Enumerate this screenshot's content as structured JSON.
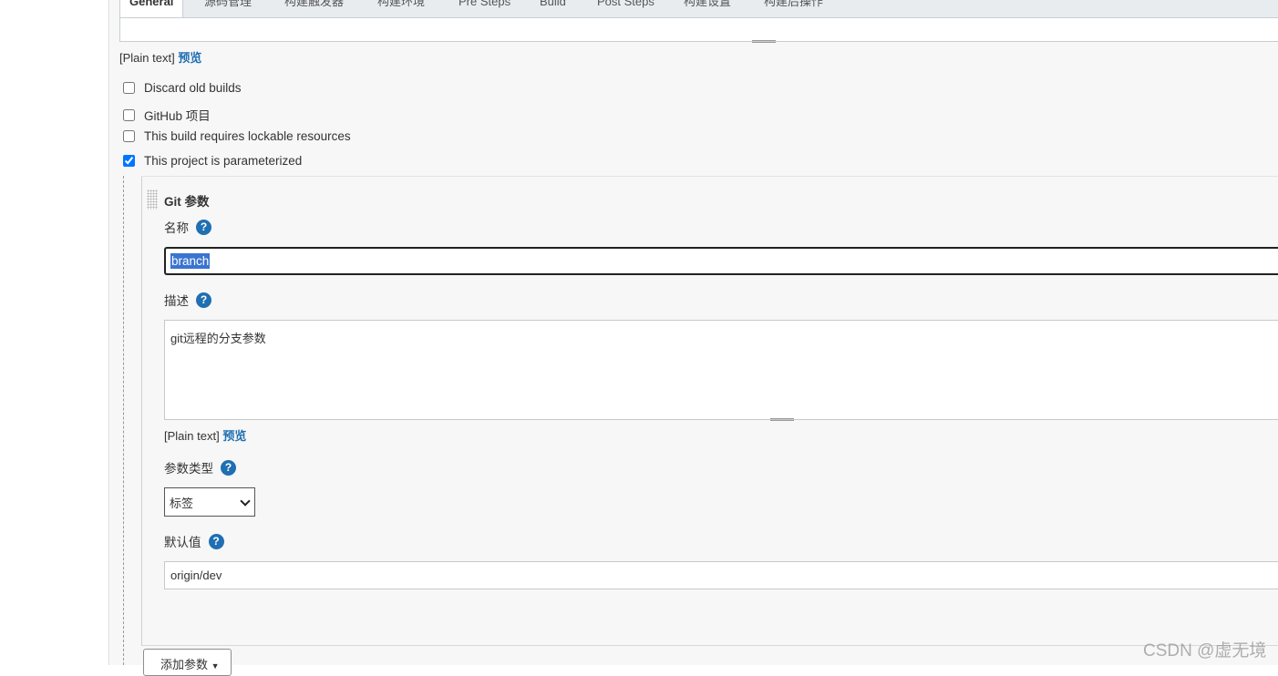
{
  "tabs": [
    {
      "label": "General",
      "active": true
    },
    {
      "label": "源码管理"
    },
    {
      "label": "构建触发器"
    },
    {
      "label": "构建环境"
    },
    {
      "label": "Pre Steps"
    },
    {
      "label": "Build"
    },
    {
      "label": "Post Steps"
    },
    {
      "label": "构建设置"
    },
    {
      "label": "构建后操作"
    }
  ],
  "description_format": {
    "plain_text": "[Plain text]",
    "preview": "预览"
  },
  "options": [
    {
      "label": "Discard old builds",
      "checked": false
    },
    {
      "label": "GitHub 项目",
      "checked": false
    },
    {
      "label": "This build requires lockable resources",
      "checked": false
    },
    {
      "label": "This project is parameterized",
      "checked": true
    }
  ],
  "git_param": {
    "title": "Git 参数",
    "name_label": "名称",
    "name_value": "branch",
    "desc_label": "描述",
    "desc_value": "git远程的分支参数",
    "plain_text": "[Plain text]",
    "preview": "预览",
    "type_label": "参数类型",
    "type_value": "标签",
    "default_label": "默认值",
    "default_value": "origin/dev"
  },
  "add_param_button": "添加参数",
  "help_glyph": "?",
  "watermark": "CSDN @虚无境",
  "colors": {
    "link": "#1f6fb2",
    "help": "#1f6fb2",
    "selection": "#3a74d1"
  }
}
